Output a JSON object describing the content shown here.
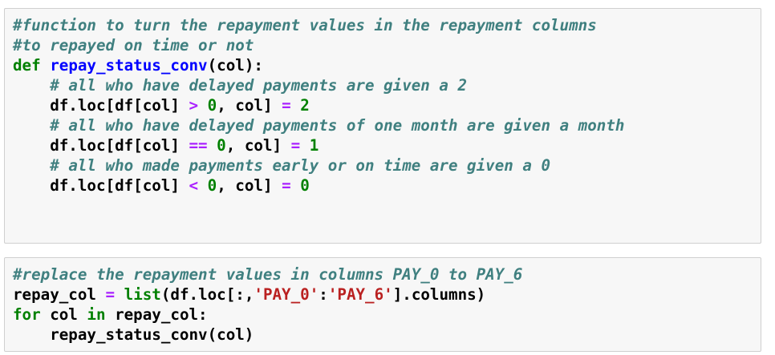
{
  "theme": {
    "cell_background": "#f7f7f7",
    "cell_border": "#cfcfcf",
    "comment_color": "#408080",
    "keyword_color": "#008000",
    "function_name_color": "#0000ff",
    "operator_color": "#aa22ff",
    "number_color": "#008000",
    "string_color": "#ba2121",
    "text_color": "#000000"
  },
  "cells": [
    {
      "lines": [
        [
          {
            "t": "comment",
            "v": "#function to turn the repayment values in the repayment columns"
          }
        ],
        [
          {
            "t": "comment",
            "v": "#to repayed on time or not"
          }
        ],
        [
          {
            "t": "keyword",
            "v": "def"
          },
          {
            "t": "plain",
            "v": " "
          },
          {
            "t": "funcname",
            "v": "repay_status_conv"
          },
          {
            "t": "plain",
            "v": "(col):"
          }
        ],
        [
          {
            "t": "plain",
            "v": "    "
          },
          {
            "t": "comment",
            "v": "# all who have delayed payments are given a 2"
          }
        ],
        [
          {
            "t": "plain",
            "v": "    df.loc[df[col] "
          },
          {
            "t": "operator",
            "v": ">"
          },
          {
            "t": "plain",
            "v": " "
          },
          {
            "t": "number",
            "v": "0"
          },
          {
            "t": "plain",
            "v": ", col] "
          },
          {
            "t": "operator",
            "v": "="
          },
          {
            "t": "plain",
            "v": " "
          },
          {
            "t": "number",
            "v": "2"
          }
        ],
        [
          {
            "t": "plain",
            "v": "    "
          },
          {
            "t": "comment",
            "v": "# all who have delayed payments of one month are given a month"
          }
        ],
        [
          {
            "t": "plain",
            "v": "    df.loc[df[col] "
          },
          {
            "t": "operator",
            "v": "=="
          },
          {
            "t": "plain",
            "v": " "
          },
          {
            "t": "number",
            "v": "0"
          },
          {
            "t": "plain",
            "v": ", col] "
          },
          {
            "t": "operator",
            "v": "="
          },
          {
            "t": "plain",
            "v": " "
          },
          {
            "t": "number",
            "v": "1"
          }
        ],
        [
          {
            "t": "plain",
            "v": "    "
          },
          {
            "t": "comment",
            "v": "# all who made payments early or on time are given a 0"
          }
        ],
        [
          {
            "t": "plain",
            "v": "    df.loc[df[col] "
          },
          {
            "t": "operator",
            "v": "<"
          },
          {
            "t": "plain",
            "v": " "
          },
          {
            "t": "number",
            "v": "0"
          },
          {
            "t": "plain",
            "v": ", col] "
          },
          {
            "t": "operator",
            "v": "="
          },
          {
            "t": "plain",
            "v": " "
          },
          {
            "t": "number",
            "v": "0"
          }
        ]
      ]
    },
    {
      "lines": [
        [
          {
            "t": "comment",
            "v": "#replace the repayment values in columns PAY_0 to PAY_6"
          }
        ],
        [
          {
            "t": "plain",
            "v": "repay_col "
          },
          {
            "t": "operator",
            "v": "="
          },
          {
            "t": "plain",
            "v": " "
          },
          {
            "t": "builtin",
            "v": "list"
          },
          {
            "t": "plain",
            "v": "(df.loc[:,"
          },
          {
            "t": "string",
            "v": "'PAY_0'"
          },
          {
            "t": "plain",
            "v": ":"
          },
          {
            "t": "string",
            "v": "'PAY_6'"
          },
          {
            "t": "plain",
            "v": "].columns)"
          }
        ],
        [
          {
            "t": "keyword",
            "v": "for"
          },
          {
            "t": "plain",
            "v": " col "
          },
          {
            "t": "keyword",
            "v": "in"
          },
          {
            "t": "plain",
            "v": " repay_col:"
          }
        ],
        [
          {
            "t": "plain",
            "v": "    repay_status_conv(col)"
          }
        ]
      ]
    }
  ]
}
